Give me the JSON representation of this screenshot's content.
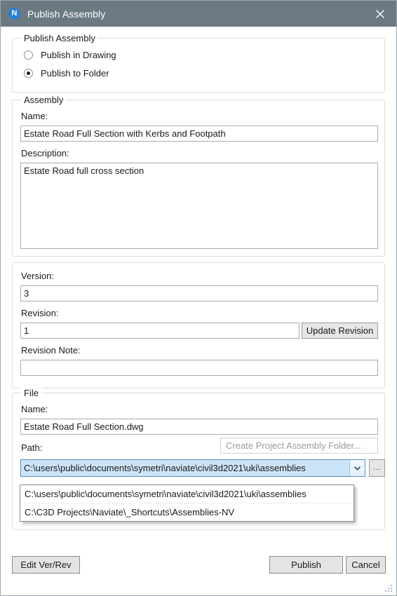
{
  "window": {
    "title": "Publish Assembly",
    "app_icon": "N",
    "close_icon": "close-icon",
    "titlebar_color": "#6b7a82",
    "accent_color": "#2a7fd4",
    "selection_color": "#cce4f7"
  },
  "publish_group": {
    "title": "Publish Assembly",
    "options": [
      {
        "label": "Publish in Drawing",
        "checked": false
      },
      {
        "label": "Publish to Folder",
        "checked": true
      }
    ]
  },
  "assembly_group": {
    "title": "Assembly",
    "name_label": "Name:",
    "name_value": "Estate Road Full Section with Kerbs and Footpath",
    "description_label": "Description:",
    "description_value": "Estate Road full cross section"
  },
  "version_group": {
    "version_label": "Version:",
    "version_value": "3",
    "revision_label": "Revision:",
    "revision_value": "1",
    "update_revision_label": "Update Revision",
    "revision_note_label": "Revision Note:",
    "revision_note_value": ""
  },
  "file_group": {
    "title": "File",
    "name_label": "Name:",
    "name_value": "Estate Road Full Section.dwg",
    "path_label": "Path:",
    "create_folder_label": "Create Project Assembly Folder...",
    "path_value": "C:\\users\\public\\documents\\symetri\\naviate\\civil3d2021\\uki\\assemblies",
    "browse_label": "...",
    "dropdown_options": [
      "C:\\users\\public\\documents\\symetri\\naviate\\civil3d2021\\uki\\assemblies",
      "C:\\C3D Projects\\Naviate\\_Shortcuts\\Assemblies-NV"
    ]
  },
  "footer": {
    "edit_ver_rev_label": "Edit Ver/Rev",
    "publish_label": "Publish",
    "cancel_label": "Cancel"
  }
}
